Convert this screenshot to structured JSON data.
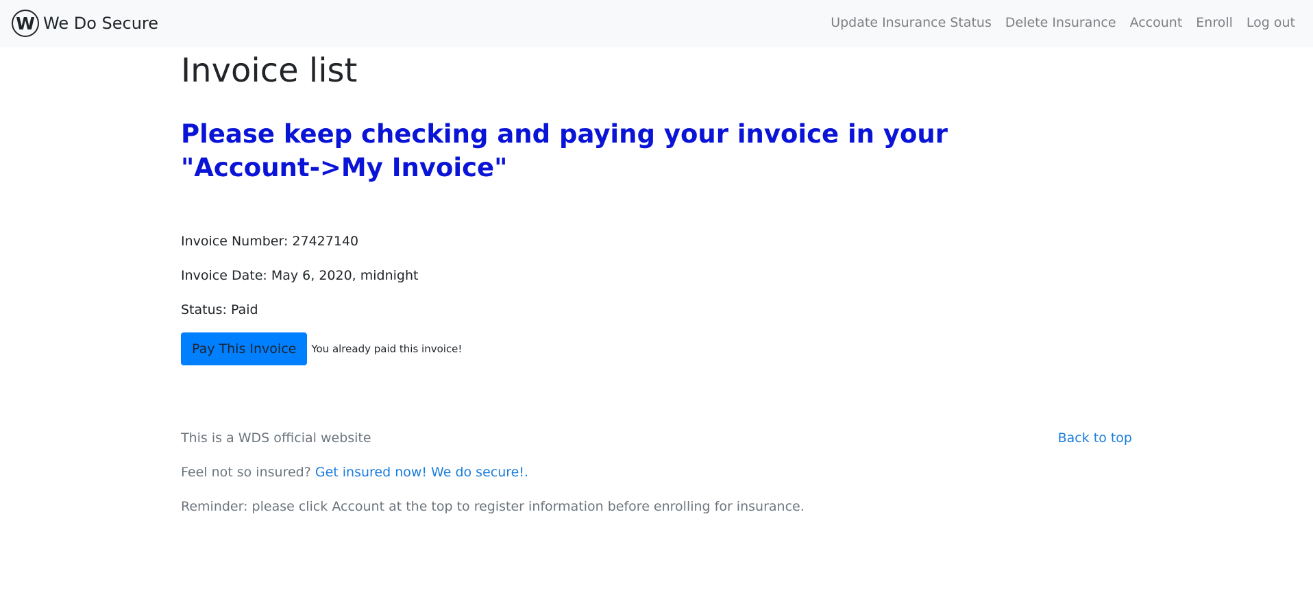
{
  "navbar": {
    "brand_logo_letter": "W",
    "brand_name": "We Do Secure",
    "links": [
      "Update Insurance Status",
      "Delete Insurance",
      "Account",
      "Enroll",
      "Log out"
    ]
  },
  "main": {
    "title": "Invoice list",
    "notice": "Please keep checking and paying your invoice in your \"Account->My Invoice\"",
    "invoice": {
      "number_label": "Invoice Number:",
      "number": "27427140",
      "date_label": "Invoice Date:",
      "date": "May 6, 2020, midnight",
      "status_label": "Status:",
      "status": "Paid"
    },
    "pay_button_label": "Pay This Invoice",
    "paid_message": "You already paid this invoice!"
  },
  "footer": {
    "official_text": "This is a WDS official website",
    "back_to_top": "Back to top",
    "insured_prompt": "Feel not so insured?",
    "insured_link": "Get insured now! We do secure!",
    "insured_suffix": ".",
    "reminder": "Reminder: please click Account at the top to register information before enrolling for insurance."
  },
  "colors": {
    "navbar_bg": "#f8f9fa",
    "notice": "#0a14d6",
    "button_bg": "#0080ff",
    "link": "#1a7cdc",
    "muted": "#6c757d"
  }
}
